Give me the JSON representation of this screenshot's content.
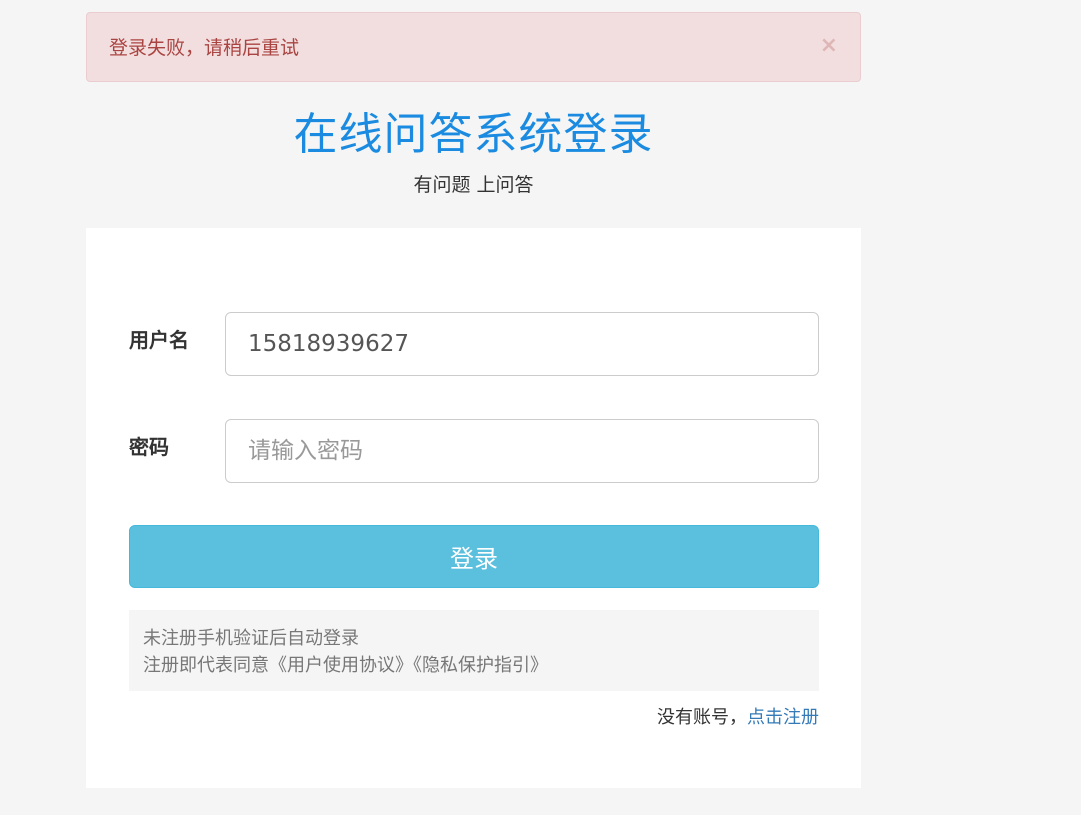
{
  "alert": {
    "message": "登录失败，请稍后重试",
    "close_glyph": "×"
  },
  "header": {
    "title": "在线问答系统登录",
    "subtitle": "有问题 上问答"
  },
  "form": {
    "username_label": "用户名",
    "username_value": "15818939627",
    "password_label": "密码",
    "password_placeholder": "请输入密码",
    "submit_label": "登录"
  },
  "notice": {
    "line1": "未注册手机验证后自动登录",
    "line2": "注册即代表同意《用户使用协议》《隐私保护指引》"
  },
  "register": {
    "prompt": "没有账号，",
    "link_label": "点击注册"
  },
  "colors": {
    "alert_bg": "#f2dede",
    "alert_text": "#a94442",
    "title": "#1a8be0",
    "button": "#5bc0de",
    "link": "#337ab7"
  }
}
